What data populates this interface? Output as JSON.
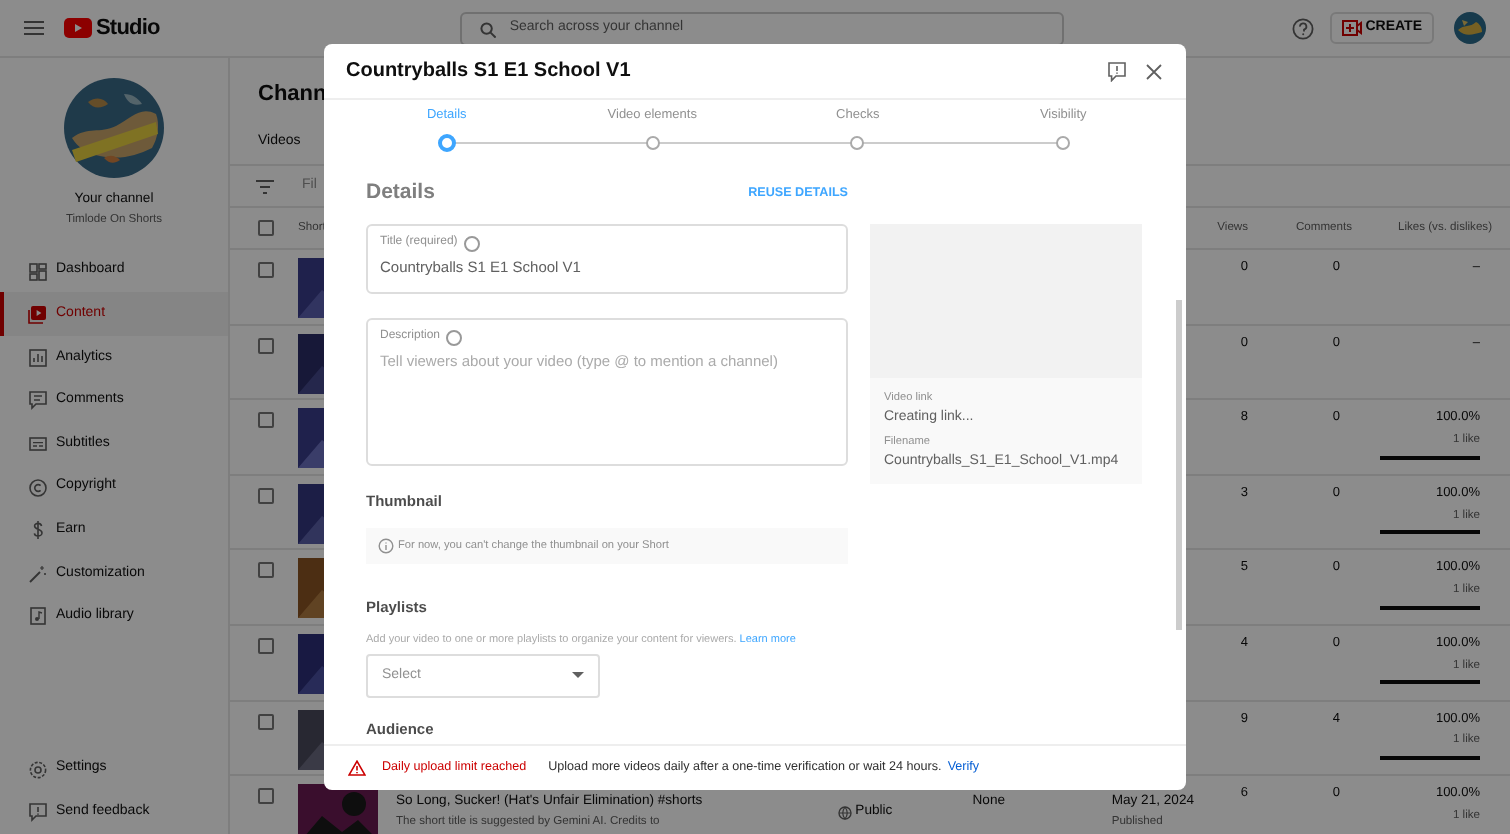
{
  "topbar": {
    "logo_text": "Studio",
    "search": {
      "placeholder": "Search across your channel"
    },
    "create_button": "CREATE"
  },
  "sidebar": {
    "channel_label": "Your channel",
    "channel_name": "Timlode On Shorts",
    "items": [
      {
        "label": "Dashboard",
        "selected": false
      },
      {
        "label": "Content",
        "selected": true
      },
      {
        "label": "Analytics",
        "selected": false
      },
      {
        "label": "Comments",
        "selected": false
      },
      {
        "label": "Subtitles",
        "selected": false
      },
      {
        "label": "Copyright",
        "selected": false
      },
      {
        "label": "Earn",
        "selected": false
      },
      {
        "label": "Customization",
        "selected": false
      },
      {
        "label": "Audio library",
        "selected": false
      }
    ],
    "footer_items": [
      {
        "label": "Settings"
      },
      {
        "label": "Send feedback"
      }
    ]
  },
  "content": {
    "title": "Chann",
    "tab": "Videos",
    "filter": "Fil",
    "select_all": {
      "checked": false
    },
    "columns": [
      "Short",
      "Views",
      "Comments",
      "Likes (vs. dislikes)"
    ],
    "rows": [
      {
        "checked": false,
        "views": "0",
        "comments": "0",
        "likes": "–"
      },
      {
        "checked": false,
        "views": "0",
        "comments": "0",
        "likes": "–"
      },
      {
        "checked": false,
        "views": "8",
        "comments": "0",
        "likes": "100.0%",
        "like_count": "1 like",
        "level": 1
      },
      {
        "checked": false,
        "views": "3",
        "comments": "0",
        "likes": "100.0%",
        "like_count": "1 like",
        "level": 1
      },
      {
        "checked": false,
        "views": "5",
        "comments": "0",
        "likes": "100.0%",
        "like_count": "1 like",
        "level": 1
      },
      {
        "checked": false,
        "views": "4",
        "comments": "0",
        "likes": "100.0%",
        "like_count": "1 like",
        "level": 1
      },
      {
        "checked": false,
        "views": "9",
        "comments": "4",
        "likes": "100.0%",
        "like_count": "1 like",
        "level": 1
      },
      {
        "checked": false,
        "title": "So Long, Sucker! (Hat's Unfair Elimination) #shorts",
        "description": "The short title is suggested by Gemini AI. Credits to",
        "visibility": "Public",
        "restrictions": "None",
        "date": "May 21, 2024",
        "status": "Published",
        "views": "6",
        "comments": "0",
        "likes": "100.0%",
        "like_count": "1 like"
      }
    ]
  },
  "modal": {
    "title": "Countryballs S1 E1 School V1",
    "steps": [
      {
        "label": "Details",
        "selected": true
      },
      {
        "label": "Video elements",
        "selected": false
      },
      {
        "label": "Checks",
        "selected": false
      },
      {
        "label": "Visibility",
        "selected": false
      }
    ],
    "heading": "Details",
    "reuse": "REUSE DETAILS",
    "title_field": {
      "label": "Title (required)",
      "value": "Countryballs S1 E1 School V1"
    },
    "description_field": {
      "label": "Description",
      "placeholder": "Tell viewers about your video (type @ to mention a channel)"
    },
    "video_link_label": "Video link",
    "video_link": "Creating link...",
    "filename_label": "Filename",
    "filename": "Countryballs_S1_E1_School_V1.mp4",
    "thumbnail": {
      "heading": "Thumbnail",
      "notice": "For now, you can't change the thumbnail on your Short"
    },
    "playlists": {
      "heading": "Playlists",
      "text": "Add your video to one or more playlists to organize your content for viewers.",
      "link": "Learn more",
      "select": {
        "placeholder": "Select"
      }
    },
    "audience": {
      "heading": "Audience"
    },
    "warning": {
      "title": "Daily upload limit reached",
      "text": "Upload more videos daily after a one-time verification or wait 24 hours.",
      "link": "Verify"
    }
  }
}
